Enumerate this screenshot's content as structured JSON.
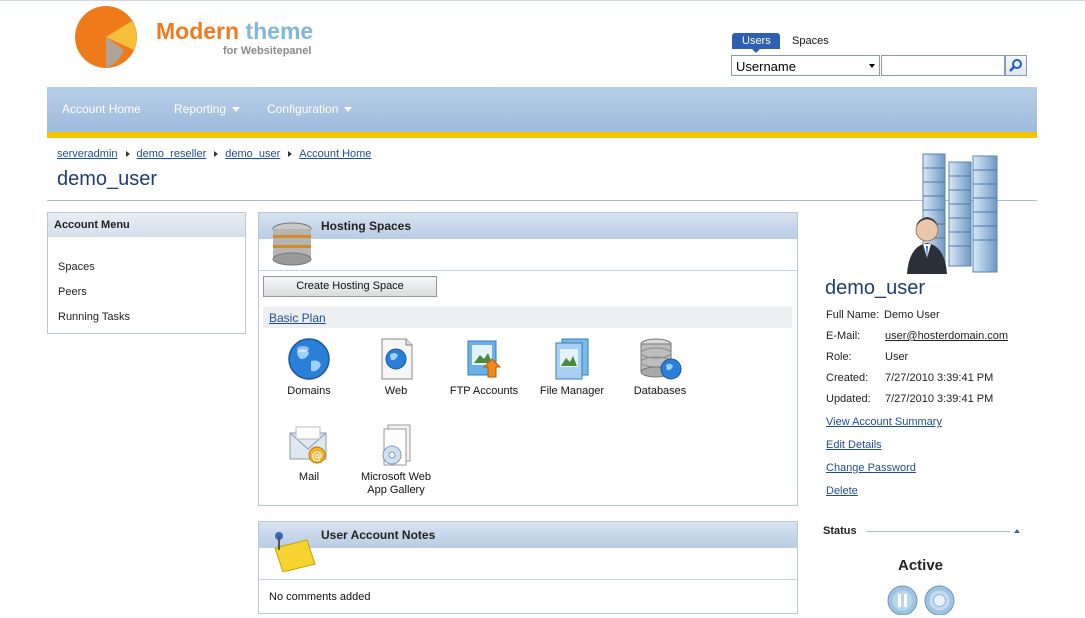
{
  "brand": {
    "title_part1": "Modern",
    "title_part2": "theme",
    "subtitle": "for Websitepanel"
  },
  "search": {
    "tabs": [
      "Users",
      "Spaces"
    ],
    "field_selected": "Username",
    "query": "",
    "icon": "magnifier-icon"
  },
  "nav": {
    "items": [
      {
        "label": "Account Home",
        "has_dropdown": false
      },
      {
        "label": "Reporting",
        "has_dropdown": true
      },
      {
        "label": "Configuration",
        "has_dropdown": true
      }
    ]
  },
  "breadcrumb": [
    "serveradmin",
    "demo_reseller",
    "demo_user",
    "Account Home"
  ],
  "page_title": "demo_user",
  "account_menu": {
    "title": "Account Menu",
    "items": [
      "Spaces",
      "Peers",
      "Running Tasks"
    ]
  },
  "hosting_spaces": {
    "title": "Hosting Spaces",
    "create_button": "Create Hosting Space",
    "plan_name": "Basic Plan",
    "tiles": [
      {
        "label": "Domains",
        "icon": "globe-icon"
      },
      {
        "label": "Web",
        "icon": "web-page-icon"
      },
      {
        "label": "FTP Accounts",
        "icon": "ftp-upload-icon"
      },
      {
        "label": "File Manager",
        "icon": "file-manager-icon"
      },
      {
        "label": "Databases",
        "icon": "database-icon"
      },
      {
        "label": "Mail",
        "icon": "mail-icon"
      },
      {
        "label": "Microsoft Web App Gallery",
        "icon": "web-app-gallery-icon"
      }
    ]
  },
  "notes": {
    "title": "User Account Notes",
    "text": "No comments added"
  },
  "user": {
    "name": "demo_user",
    "fields": [
      {
        "label": "Full Name:",
        "value": "Demo User"
      },
      {
        "label": "E-Mail:",
        "value": "user@hosterdomain.com"
      },
      {
        "label": "Role:",
        "value": "User"
      },
      {
        "label": "Created:",
        "value": "7/27/2010 3:39:41 PM"
      },
      {
        "label": "Updated:",
        "value": "7/27/2010 3:39:41 PM"
      }
    ],
    "actions": [
      "View Account Summary",
      "Edit Details",
      "Change Password",
      "Delete"
    ]
  },
  "status": {
    "title": "Status",
    "value": "Active",
    "buttons": [
      "pause-icon",
      "stop-icon"
    ]
  },
  "colors": {
    "nav_bg": "#a9c3e2",
    "nav_accent": "#f5c400",
    "title_blue": "#1f3e6e",
    "link_blue": "#1f4e8c",
    "brand_orange": "#ee7b22",
    "brand_light_blue": "#7fb8da"
  }
}
